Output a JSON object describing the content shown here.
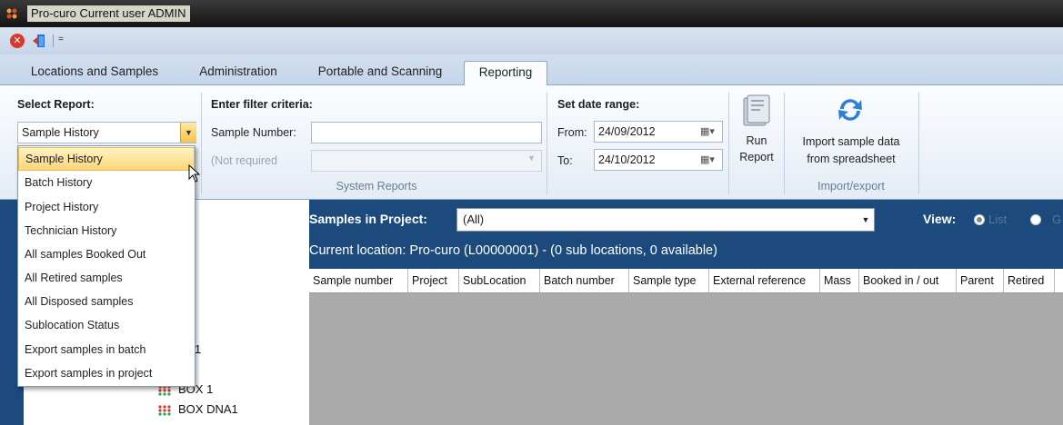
{
  "window": {
    "title": "Pro-curo  Current user ADMIN"
  },
  "quick_access": {
    "more_symbol": "="
  },
  "tabs": [
    {
      "label": "Locations and Samples"
    },
    {
      "label": "Administration"
    },
    {
      "label": "Portable and Scanning"
    },
    {
      "label": "Reporting"
    }
  ],
  "ribbon": {
    "select_report": {
      "label": "Select Report:",
      "value": "Sample History"
    },
    "filter": {
      "label": "Enter filter criteria:",
      "sample_number_label": "Sample Number:",
      "sample_number_value": "",
      "not_required_label": "(Not required",
      "caption": "System Reports"
    },
    "date_range": {
      "label": "Set date range:",
      "from_label": "From:",
      "from_value": "24/09/2012",
      "to_label": "To:",
      "to_value": "24/10/2012"
    },
    "run_report": {
      "line1": "Run",
      "line2": "Report"
    },
    "import": {
      "line1": "Import sample data",
      "line2": "from spreadsheet",
      "caption": "Import/export"
    }
  },
  "report_options": [
    "Sample History",
    "Batch History",
    "Project History",
    "Technician History",
    "All samples Booked Out",
    "All Retired samples",
    "All Disposed samples",
    "Sublocation Status",
    "Export samples in batch",
    "Export samples in project"
  ],
  "main": {
    "samples_in_project_label": "Samples in Project:",
    "project_value": "(All)",
    "view_label": "View:",
    "view_options": [
      "List",
      "G"
    ],
    "location_line": "Current location: Pro-curo  (L00000001)  -  (0 sub locations, 0 available)",
    "columns": [
      "Sample number",
      "Project",
      "SubLocation",
      "Batch number",
      "Sample type",
      "External reference",
      "Mass",
      "Booked in / out",
      "Parent",
      "Retired",
      ""
    ]
  },
  "tree": {
    "partial_text": "1",
    "nodes": [
      "BOX 1",
      "BOX DNA1"
    ]
  },
  "colors": {
    "accent": "#1c4a7c",
    "selected": "#fbd57a"
  }
}
